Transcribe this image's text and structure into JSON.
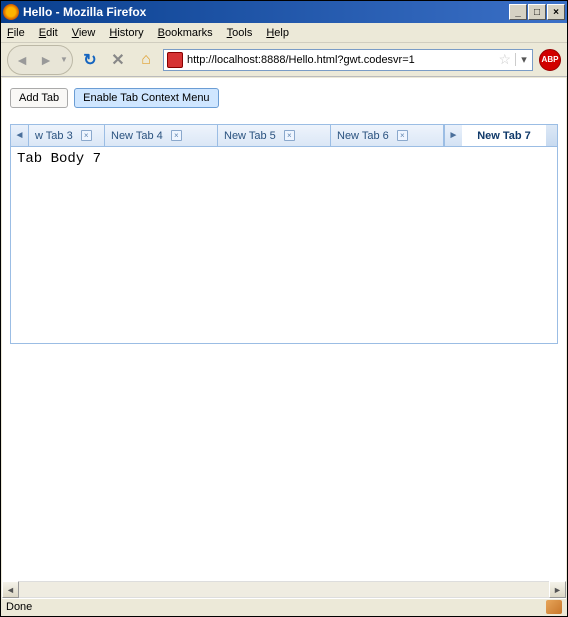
{
  "window": {
    "title": "Hello - Mozilla Firefox"
  },
  "menubar": {
    "items": [
      "File",
      "Edit",
      "View",
      "History",
      "Bookmarks",
      "Tools",
      "Help"
    ]
  },
  "toolbar": {
    "url": "http://localhost:8888/Hello.html?gwt.codesvr=1",
    "abp_label": "ABP"
  },
  "page": {
    "add_tab_label": "Add Tab",
    "context_menu_label": "Enable Tab Context Menu",
    "tabs": [
      {
        "label": "w Tab 3",
        "closable": true
      },
      {
        "label": "New Tab 4",
        "closable": true
      },
      {
        "label": "New Tab 5",
        "closable": true
      },
      {
        "label": "New Tab 6",
        "closable": true
      },
      {
        "label": "New Tab 7",
        "active": true
      }
    ],
    "body_text": "Tab Body 7"
  },
  "statusbar": {
    "text": "Done"
  }
}
